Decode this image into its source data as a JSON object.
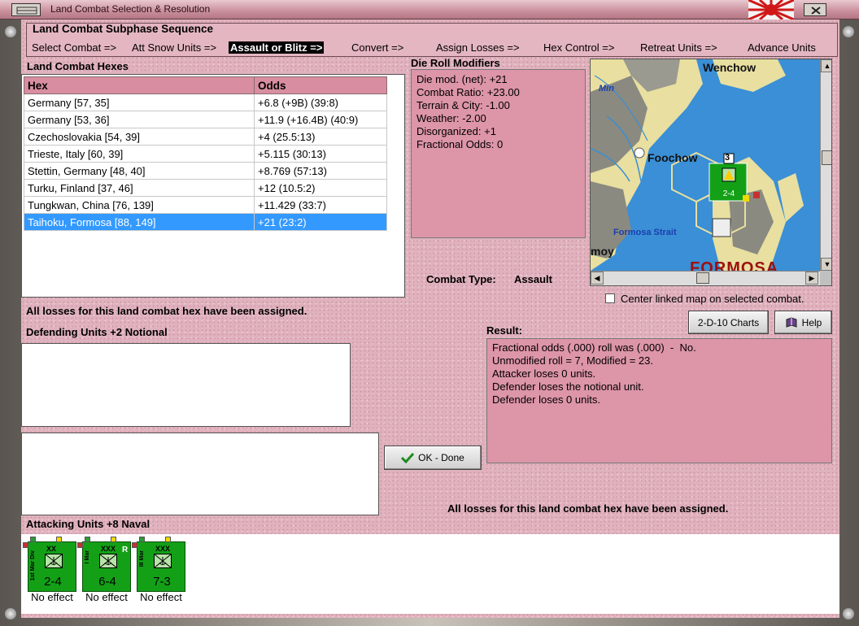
{
  "window": {
    "title": "Land Combat Selection & Resolution"
  },
  "subphase": {
    "title": "Land Combat Subphase Sequence",
    "steps": [
      {
        "label": "Select Combat =>"
      },
      {
        "label": "Att Snow Units =>"
      },
      {
        "label": "Assault or Blitz =>",
        "active": true
      },
      {
        "label": "Convert =>"
      },
      {
        "label": "Assign Losses =>"
      },
      {
        "label": "Hex Control =>"
      },
      {
        "label": "Retreat Units =>"
      },
      {
        "label": "Advance Units"
      }
    ]
  },
  "hexes": {
    "label": "Land Combat Hexes",
    "columns": [
      "Hex",
      "Odds"
    ],
    "rows": [
      [
        "Germany [57, 35]",
        "+6.8 (+9B) (39:8)"
      ],
      [
        "Germany [53, 36]",
        "+11.9 (+16.4B) (40:9)"
      ],
      [
        "Czechoslovakia [54, 39]",
        "+4 (25.5:13)"
      ],
      [
        "Trieste, Italy [60, 39]",
        "+5.115 (30:13)"
      ],
      [
        "Stettin, Germany [48, 40]",
        "+8.769 (57:13)"
      ],
      [
        "Turku, Finland [37, 46]",
        "+12 (10.5:2)"
      ],
      [
        "Tungkwan, China [76, 139]",
        "+11.429 (33:7)"
      ],
      [
        "Taihoku, Formosa [88, 149]",
        "+21 (23:2)"
      ]
    ],
    "selected_index": 7
  },
  "modifiers": {
    "label": "Die Roll Modifiers",
    "lines": [
      "Die mod. (net): +21",
      "",
      "Combat Ratio: +23.00",
      "Terrain & City: -1.00",
      "Weather: -2.00",
      "Disorganized: +1",
      "Fractional Odds: 0"
    ]
  },
  "map": {
    "labels": {
      "wenchow": "Wenchow",
      "min": "Min",
      "foochow": "Foochow",
      "strait": "Formosa Strait",
      "amoy": "moy",
      "formosa": "FORMOSA"
    },
    "stack_count": "3",
    "counter_strength": "2-4"
  },
  "combat_type": {
    "label": "Combat Type:",
    "value": "Assault"
  },
  "center_map": {
    "label": "Center linked map on selected combat.",
    "checked": false
  },
  "losses_msg": "All losses for this land combat hex have been assigned.",
  "defending": {
    "label": "Defending Units +2 Notional"
  },
  "buttons": {
    "charts": "2-D-10 Charts",
    "help": "Help",
    "ok": "OK - Done"
  },
  "result": {
    "label": "Result:",
    "lines": [
      "Fractional odds (.000) roll was (.000)  -  No.",
      "Unmodified roll = 7, Modified = 23.",
      "Attacker loses 0 units.",
      "Defender loses the notional unit.",
      "Defender loses 0 units."
    ]
  },
  "attacking": {
    "label": "Attacking Units +8 Naval",
    "units": [
      {
        "name": "1st Mar Div",
        "size": "XX",
        "strength": "2-4",
        "effect": "No effect",
        "reserve": ""
      },
      {
        "name": "I Mar",
        "size": "XXX",
        "strength": "6-4",
        "effect": "No effect",
        "reserve": "R"
      },
      {
        "name": "III Mar",
        "size": "XXX",
        "strength": "7-3",
        "effect": "No effect",
        "reserve": ""
      }
    ]
  },
  "colors": {
    "panel_pink": "#dd95a8",
    "header_pink": "#d88ea0",
    "selection": "#3399ff",
    "counter_green": "#13a017"
  }
}
